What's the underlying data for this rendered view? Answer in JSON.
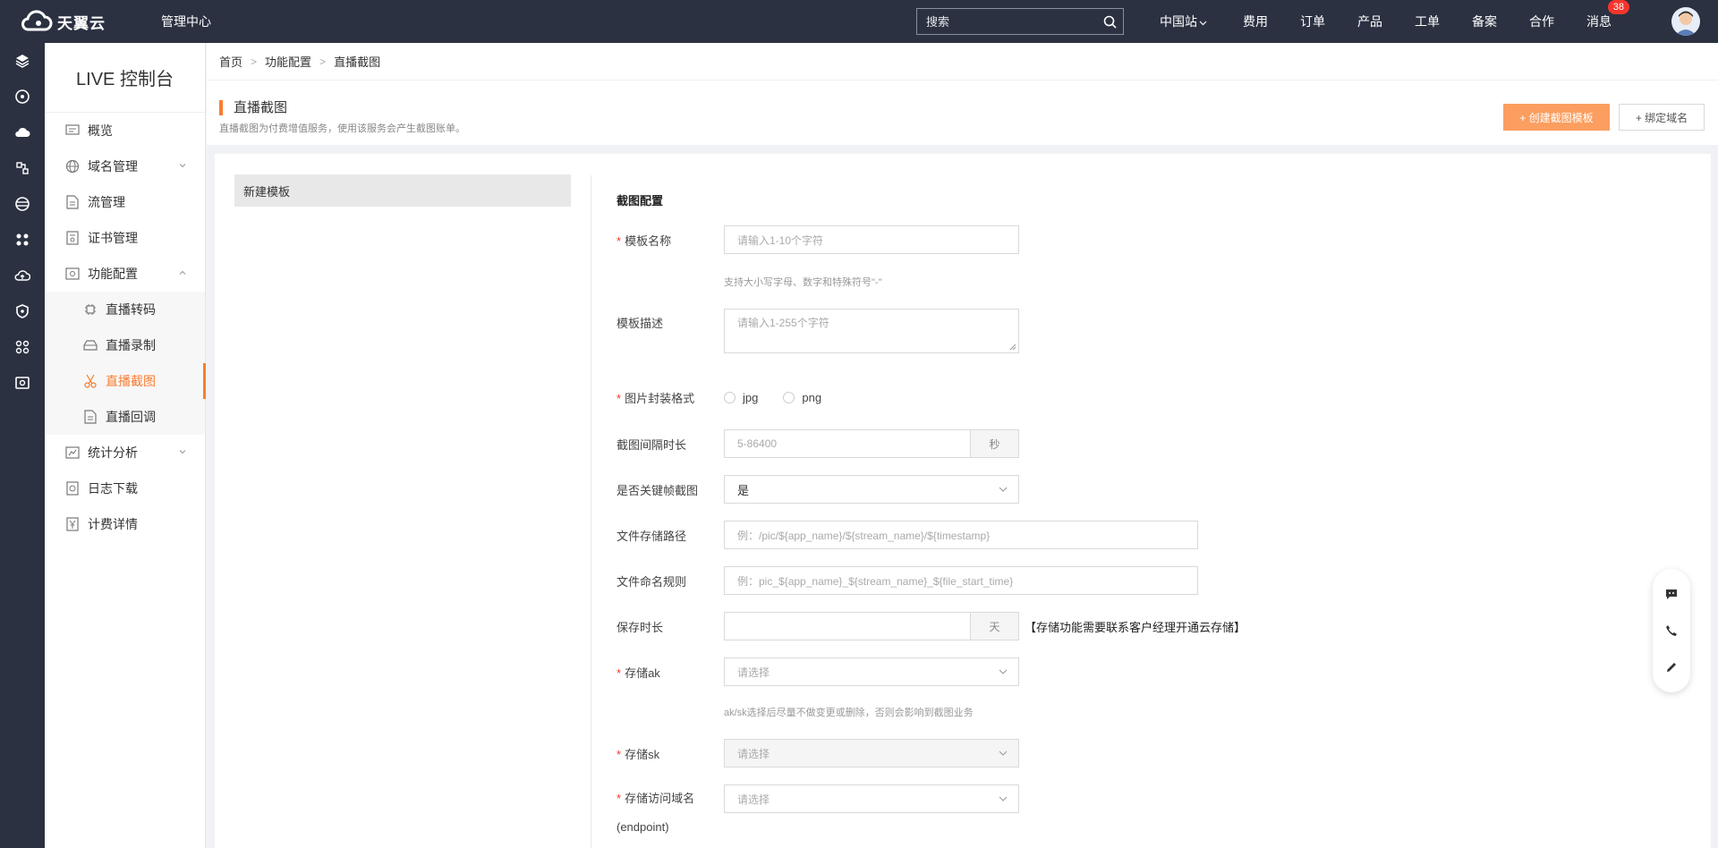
{
  "topbar": {
    "brand": "天翼云",
    "console": "管理中心",
    "search_placeholder": "搜索",
    "nav": [
      "中国站",
      "费用",
      "订单",
      "产品",
      "工单",
      "备案",
      "合作",
      "消息"
    ],
    "message_count": "38"
  },
  "sidebar": {
    "title": "LIVE 控制台",
    "items": [
      {
        "label": "概览"
      },
      {
        "label": "域名管理"
      },
      {
        "label": "流管理"
      },
      {
        "label": "证书管理"
      },
      {
        "label": "功能配置"
      },
      {
        "label": "统计分析"
      },
      {
        "label": "日志下载"
      },
      {
        "label": "计费详情"
      }
    ],
    "sub_items": [
      {
        "label": "直播转码"
      },
      {
        "label": "直播录制"
      },
      {
        "label": "直播截图"
      },
      {
        "label": "直播回调"
      }
    ]
  },
  "breadcrumb": [
    "首页",
    "功能配置",
    "直播截图"
  ],
  "header": {
    "title": "直播截图",
    "subtitle": "直播截图为付费增值服务，使用该服务会产生截图账单。",
    "create_button": "+ 创建截图模板",
    "bind_button": "+ 绑定域名"
  },
  "template_list": {
    "items": [
      "新建模板"
    ]
  },
  "form": {
    "section_title": "截图配置",
    "name_label": "模板名称",
    "name_placeholder": "请输入1-10个字符",
    "name_hint": "支持大小写字母、数字和特殊符号\"-\"",
    "desc_label": "模板描述",
    "desc_placeholder": "请输入1-255个字符",
    "format_label": "图片封装格式",
    "format_options": [
      "jpg",
      "png"
    ],
    "interval_label": "截图间隔时长",
    "interval_placeholder": "5-86400",
    "interval_unit": "秒",
    "keyframe_label": "是否关键帧截图",
    "keyframe_value": "是",
    "path_label": "文件存储路径",
    "path_placeholder": "例：/pic/${app_name}/${stream_name}/${timestamp}",
    "naming_label": "文件命名规则",
    "naming_placeholder": "例：pic_${app_name}_${stream_name}_${file_start_time}",
    "retention_label": "保存时长",
    "retention_unit": "天",
    "retention_note": "【存储功能需要联系客户经理开通云存储】",
    "ak_label": "存储ak",
    "ak_placeholder": "请选择",
    "ak_hint": "ak/sk选择后尽量不做变更或删除，否则会影响到截图业务",
    "sk_label": "存储sk",
    "sk_placeholder": "请选择",
    "endpoint_label": "存储访问域名",
    "endpoint_label2": "(endpoint)",
    "endpoint_placeholder": "请选择"
  },
  "colors": {
    "accent": "#fb7c2f",
    "topbar": "#2b3141",
    "primary_button": "#fb9e5f"
  }
}
